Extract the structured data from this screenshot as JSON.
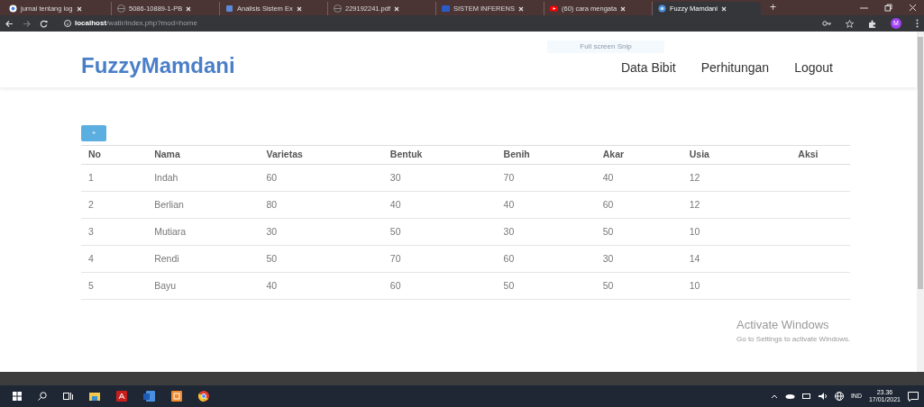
{
  "browser": {
    "tabs": [
      {
        "title": "jurnal tentang log",
        "selected": false,
        "kind": "google"
      },
      {
        "title": "5086-10889-1-PB",
        "selected": false,
        "kind": "globe"
      },
      {
        "title": "Analisis Sistem Ex",
        "selected": false,
        "kind": "app"
      },
      {
        "title": "229192241.pdf",
        "selected": false,
        "kind": "globe"
      },
      {
        "title": "SISTEM INFERENS",
        "selected": false,
        "kind": "doc"
      },
      {
        "title": "(60) cara mengata",
        "selected": false,
        "kind": "video"
      },
      {
        "title": "Fuzzy Mamdani",
        "selected": true,
        "kind": "site"
      }
    ],
    "new_tab": "+",
    "address": "**localhost**/watir/index.php?mod=home",
    "profile": "M"
  },
  "navbar": {
    "brand": "FuzzyMamdani",
    "links": [
      "Data Bibit",
      "Perhitungan",
      "Logout"
    ]
  },
  "snip_label": "Full screen Snip",
  "add_button": "+",
  "table": {
    "columns": [
      "No",
      "Nama",
      "Varietas",
      "Bentuk",
      "Benih",
      "Akar",
      "Usia",
      "Aksi"
    ],
    "rows": [
      [
        "1",
        "Indah",
        "60",
        "30",
        "70",
        "40",
        "12"
      ],
      [
        "2",
        "Berlian",
        "80",
        "40",
        "40",
        "60",
        "12"
      ],
      [
        "3",
        "Mutiara",
        "30",
        "50",
        "30",
        "50",
        "10"
      ],
      [
        "4",
        "Rendi",
        "50",
        "70",
        "60",
        "30",
        "14"
      ],
      [
        "5",
        "Bayu",
        "40",
        "60",
        "50",
        "50",
        "10"
      ]
    ]
  },
  "activation": {
    "title": "Activate Windows",
    "subtitle": "Go to Settings to activate Windows."
  },
  "taskbar": {
    "language": "IND",
    "time": "23.36",
    "date": "17/01/2021"
  }
}
